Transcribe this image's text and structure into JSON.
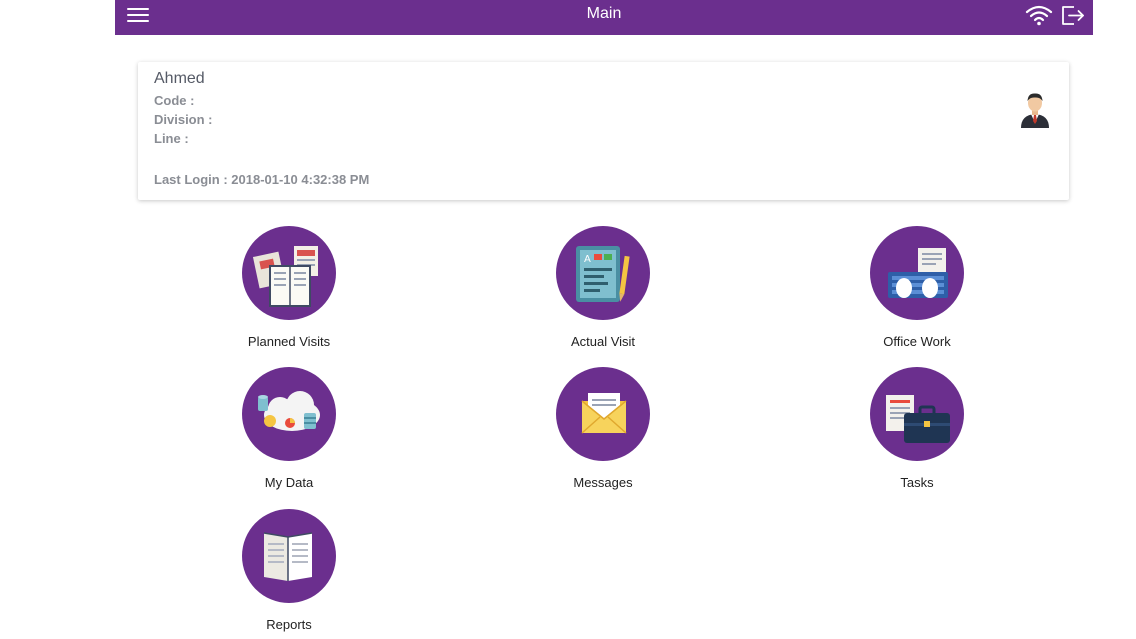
{
  "header": {
    "title": "Main",
    "menu_icon": "menu-icon",
    "wifi_icon": "wifi-icon",
    "logout_icon": "logout-icon"
  },
  "user": {
    "name": "Ahmed",
    "code_label": "Code :",
    "division_label": "Division :",
    "line_label": "Line :",
    "last_login": "Last Login : 2018-01-10 4:32:38 PM",
    "avatar_icon": "businessman-avatar-icon"
  },
  "tiles": [
    {
      "label": "Planned Visits",
      "icon": "planned-visits-icon"
    },
    {
      "label": "Actual Visit",
      "icon": "actual-visit-icon"
    },
    {
      "label": "Office Work",
      "icon": "office-work-icon"
    },
    {
      "label": "My Data",
      "icon": "my-data-icon"
    },
    {
      "label": "Messages",
      "icon": "messages-icon"
    },
    {
      "label": "Tasks",
      "icon": "tasks-icon"
    },
    {
      "label": "Reports",
      "icon": "reports-icon"
    }
  ],
  "colors": {
    "brand_purple": "#6b2f8e",
    "header_text": "#ffffff",
    "muted_text": "#8a8d94"
  }
}
